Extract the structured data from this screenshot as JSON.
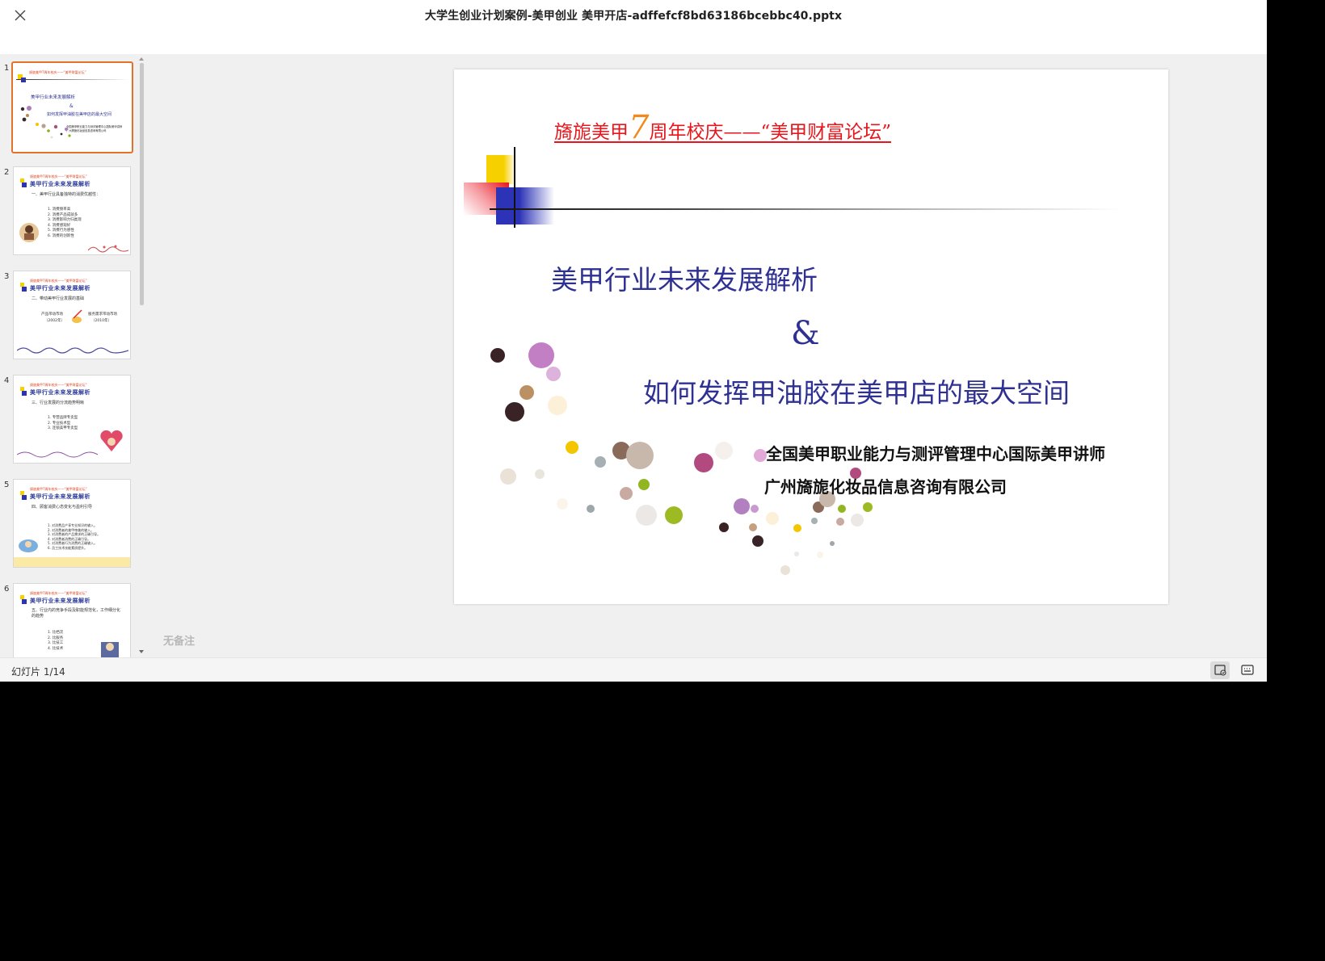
{
  "window": {
    "title": "大学生创业计划案例-美甲创业 美甲开店-adffefcf8bd63186bcebbc40.pptx"
  },
  "thumbnails": [
    {
      "num": "1",
      "title": "旖旎美甲7周年校庆——“美甲财富论坛”",
      "heading": "美甲行业未来发展解析",
      "amp": "&",
      "line2": "如何发挥甲油胶在美甲店的最大空间",
      "line3": "全国美甲职业能力与测评管理中心国际美甲讲师",
      "line4": "广州旖旎化妆品信息咨询有限公司"
    },
    {
      "num": "2",
      "title": "旖旎美甲7周年校庆——“美甲财富论坛”",
      "heading": "美甲行业未来发展解析",
      "sub": "一、美甲行业具备独特的消费优越性：",
      "items": [
        "1.  消费频率高",
        "2.  消费产品成就多",
        "3.  消费影响力归类现",
        "4.  消费感观好",
        "5.  消费行为感性",
        "6.  消费的创新性"
      ]
    },
    {
      "num": "3",
      "title": "旖旎美甲7周年校庆——“美甲财富论坛”",
      "heading": "美甲行业未来发展解析",
      "sub": "二、带动美甲行业发展的基础",
      "items": [
        "产品带动市场",
        "（2002年）",
        "服务需求带动市场",
        "（2010年）"
      ]
    },
    {
      "num": "4",
      "title": "旖旎美甲7周年校庆——“美甲财富论坛”",
      "heading": "美甲行业未来发展解析",
      "sub": "三、行业发展的分流趋势明晰",
      "items": [
        "1.  专营品牌专卖型",
        "2.  专业技术型",
        "3.  连锁美甲专卖型"
      ]
    },
    {
      "num": "5",
      "title": "旖旎美甲7周年校庆——“美甲财富论坛”",
      "heading": "美甲行业未来发展解析",
      "sub": "四、顾客消费心态变化与盈利引导",
      "items": [
        "1.  对消费品产享专业知识的输入。",
        "2.  对消费者的美甲审美的输入。",
        "3.  对消费者的产品需求的正确引导。",
        "4.  对消费者消费的正确引导。",
        "5.  对消费者行为消费的正确输入。",
        "6.  员工技术技能素质提升。"
      ]
    },
    {
      "num": "6",
      "title": "旖旎美甲7周年校庆——“美甲财富论坛”",
      "heading": "美甲行业未来发展解析",
      "sub": "五、行业内的竞争手段及职能规范化，工作细分化的趋势",
      "items": [
        "1.  比档次",
        "2.  比服务",
        "3.  比技工",
        "4.  比技术"
      ]
    }
  ],
  "slide": {
    "top_title_prefix": "旖旎美甲",
    "top_title_number": "7",
    "top_title_suffix": "周年校庆——“美甲财富论坛”",
    "heading": "美甲行业未来发展解析",
    "ampersand": "&",
    "subheading": "如何发挥甲油胶在美甲店的最大空间",
    "presenter_role": "全国美甲职业能力与测评管理中心国际美甲讲师",
    "presenter_company": "广州旖旎化妆品信息咨询有限公司"
  },
  "notes_placeholder": "无备注",
  "status": {
    "slide_counter": "幻灯片 1/14"
  },
  "colors": {
    "accent_active": "#e0722a",
    "slide_title_red": "#e8161c",
    "slide_heading_blue": "#2e3192",
    "number_orange": "#f08a1d"
  },
  "icons": {
    "close": "close-icon",
    "view_normal": "normal-view-icon",
    "view_notes": "notes-view-icon"
  }
}
